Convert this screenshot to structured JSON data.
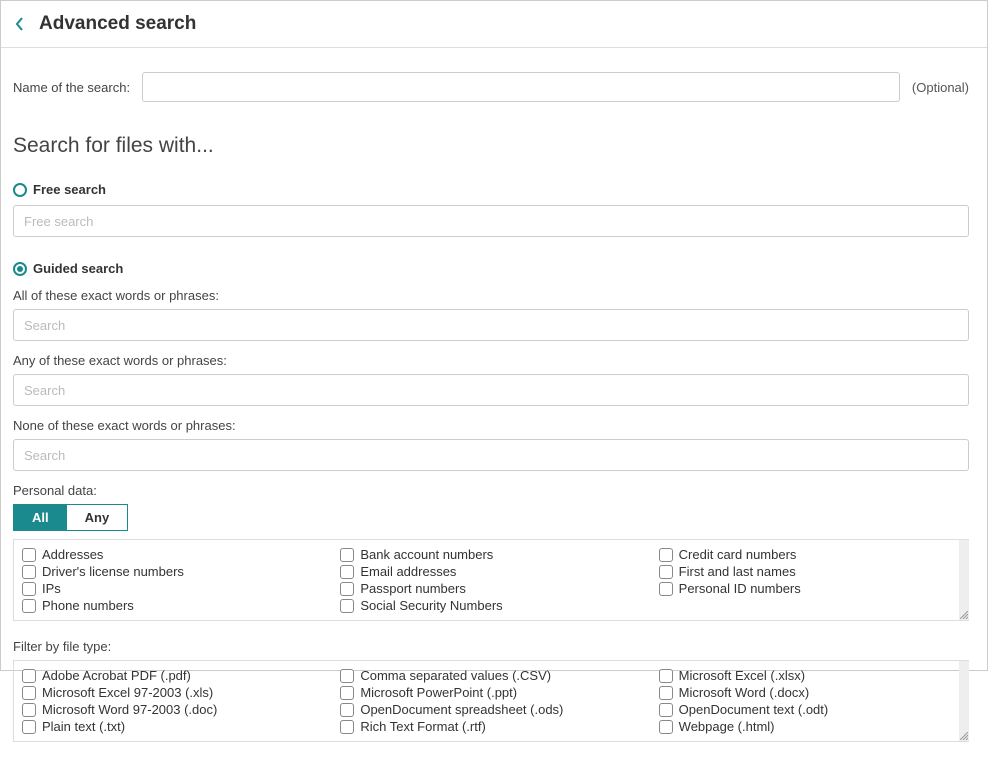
{
  "header": {
    "title": "Advanced search"
  },
  "nameRow": {
    "label": "Name of the search:",
    "value": "",
    "optional": "(Optional)"
  },
  "sectionTitle": "Search for files with...",
  "freeSearch": {
    "label": "Free search",
    "placeholder": "Free search",
    "selected": false
  },
  "guidedSearch": {
    "label": "Guided search",
    "selected": true,
    "all": {
      "label": "All of these exact words or phrases:",
      "placeholder": "Search"
    },
    "any": {
      "label": "Any of these exact words or phrases:",
      "placeholder": "Search"
    },
    "none": {
      "label": "None of these exact words or phrases:",
      "placeholder": "Search"
    }
  },
  "personalData": {
    "label": "Personal data:",
    "toggle": {
      "all": "All",
      "any": "Any",
      "active": "all"
    },
    "cols": [
      [
        "Addresses",
        "Driver's license numbers",
        "IPs",
        "Phone numbers"
      ],
      [
        "Bank account numbers",
        "Email addresses",
        "Passport numbers",
        "Social Security Numbers"
      ],
      [
        "Credit card numbers",
        "First and last names",
        "Personal ID numbers"
      ]
    ]
  },
  "fileTypes": {
    "label": "Filter by file type:",
    "cols": [
      [
        "Adobe Acrobat PDF (.pdf)",
        "Microsoft Excel 97-2003 (.xls)",
        "Microsoft Word 97-2003 (.doc)",
        "Plain text (.txt)"
      ],
      [
        "Comma separated values (.CSV)",
        "Microsoft PowerPoint (.ppt)",
        "OpenDocument spreadsheet (.ods)",
        "Rich Text Format (.rtf)"
      ],
      [
        "Microsoft Excel (.xlsx)",
        "Microsoft Word (.docx)",
        "OpenDocument text (.odt)",
        "Webpage (.html)"
      ]
    ]
  }
}
